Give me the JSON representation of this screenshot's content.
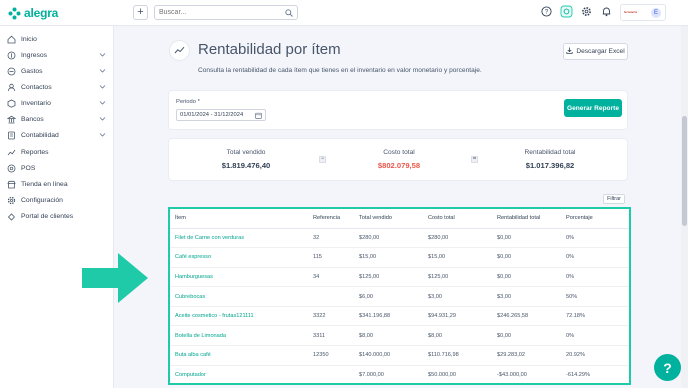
{
  "app": {
    "brand": "alegra"
  },
  "topbar": {
    "plus_label": "+",
    "search_placeholder": "Buscar...",
    "company_brand": "ferreteria",
    "avatar_initial": "E"
  },
  "sidebar": {
    "items": [
      {
        "label": "Inicio",
        "icon": "home-icon",
        "expandable": false
      },
      {
        "label": "Ingresos",
        "icon": "income-icon",
        "expandable": true
      },
      {
        "label": "Gastos",
        "icon": "expense-icon",
        "expandable": true
      },
      {
        "label": "Contactos",
        "icon": "contacts-icon",
        "expandable": true
      },
      {
        "label": "Inventario",
        "icon": "inventory-icon",
        "expandable": true
      },
      {
        "label": "Bancos",
        "icon": "bank-icon",
        "expandable": true
      },
      {
        "label": "Contabilidad",
        "icon": "accounting-icon",
        "expandable": true
      },
      {
        "label": "Reportes",
        "icon": "reports-icon",
        "expandable": false
      },
      {
        "label": "POS",
        "icon": "pos-icon",
        "expandable": false
      },
      {
        "label": "Tienda en línea",
        "icon": "store-icon",
        "expandable": false
      },
      {
        "label": "Configuración",
        "icon": "gear-icon",
        "expandable": false
      },
      {
        "label": "Portal de clientes",
        "icon": "portal-icon",
        "expandable": false
      }
    ]
  },
  "header": {
    "title": "Rentabilidad por ítem",
    "subtitle": "Consulta la rentabilidad de cada ítem que tienes en el inventario en valor monetario y porcentaje.",
    "excel_button": "Descargar Excel"
  },
  "filters": {
    "period_label": "Periodo *",
    "period_value": "01/01/2024 - 31/12/2024",
    "report_button": "Generar Reporte",
    "filter_button": "Filtrar"
  },
  "totals": {
    "sold_label": "Total vendido",
    "sold_value": "$1.819.476,40",
    "op_minus": "−",
    "cost_label": "Costo total",
    "cost_value": "$802.079,58",
    "op_equals": "=",
    "profit_label": "Rentabilidad total",
    "profit_value": "$1.017.396,82"
  },
  "table": {
    "headers": [
      "Ítem",
      "Referencia",
      "Total vendido",
      "Costo total",
      "Rentabilidad total",
      "Porcentaje"
    ],
    "rows": [
      [
        "Filet de Carne con verduras",
        "32",
        "$280,00",
        "$280,00",
        "$0,00",
        "0%"
      ],
      [
        "Café espresso",
        "115",
        "$15,00",
        "$15,00",
        "$0,00",
        "0%"
      ],
      [
        "Hamburguesas",
        "34",
        "$125,00",
        "$125,00",
        "$0,00",
        "0%"
      ],
      [
        "Cubrebocas",
        "",
        "$6,00",
        "$3,00",
        "$3,00",
        "50%"
      ],
      [
        "Aceite cosmetico - frutas121111",
        "3322",
        "$341.196,88",
        "$94.931,29",
        "$246.265,58",
        "72.18%"
      ],
      [
        "Botella de Limonada",
        "3311",
        "$8,00",
        "$8,00",
        "$0,00",
        "0%"
      ],
      [
        "Buta alba café",
        "12350",
        "$140.000,00",
        "$110.716,98",
        "$29.283,02",
        "20.92%"
      ],
      [
        "Computador",
        "",
        "$7.000,00",
        "$50.000,00",
        "-$43.000,00",
        "-614.29%"
      ]
    ]
  },
  "colors": {
    "accent": "#00b19d",
    "highlight_border": "#1fcaa8",
    "arrow": "#1fcaa8",
    "negative": "#e9574a"
  },
  "help": {
    "label": "?"
  }
}
